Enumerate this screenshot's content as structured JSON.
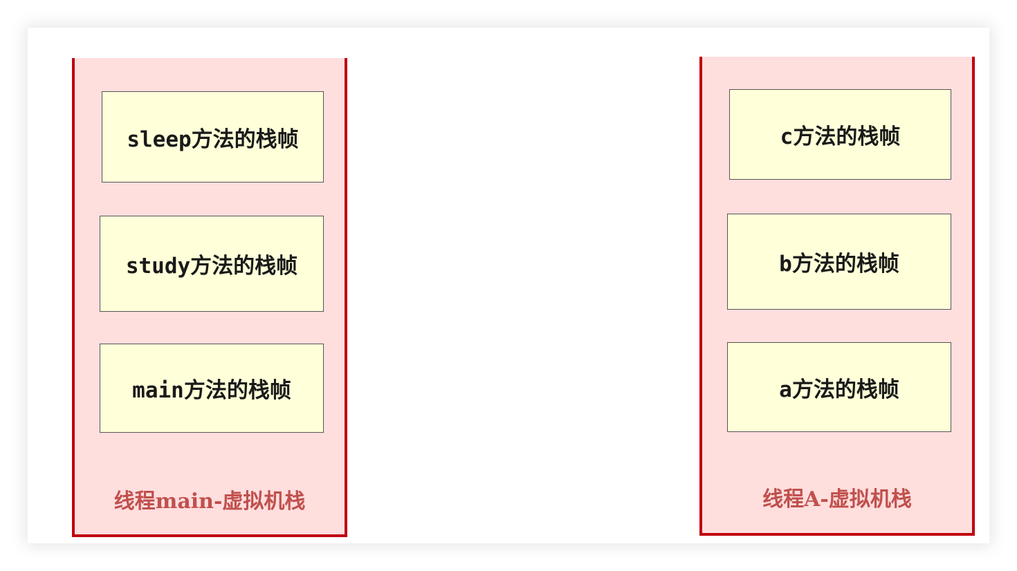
{
  "left_stack": {
    "label": "线程main-虚拟机栈",
    "frames": [
      "sleep方法的栈帧",
      "study方法的栈帧",
      "main方法的栈帧"
    ]
  },
  "right_stack": {
    "label": "线程A-虚拟机栈",
    "frames": [
      "c方法的栈帧",
      "b方法的栈帧",
      "a方法的栈帧"
    ]
  },
  "colors": {
    "stack_fill": "#ffdede",
    "stack_border": "#c0000f",
    "frame_fill": "#ffffd9",
    "label_color": "#c0504d"
  }
}
